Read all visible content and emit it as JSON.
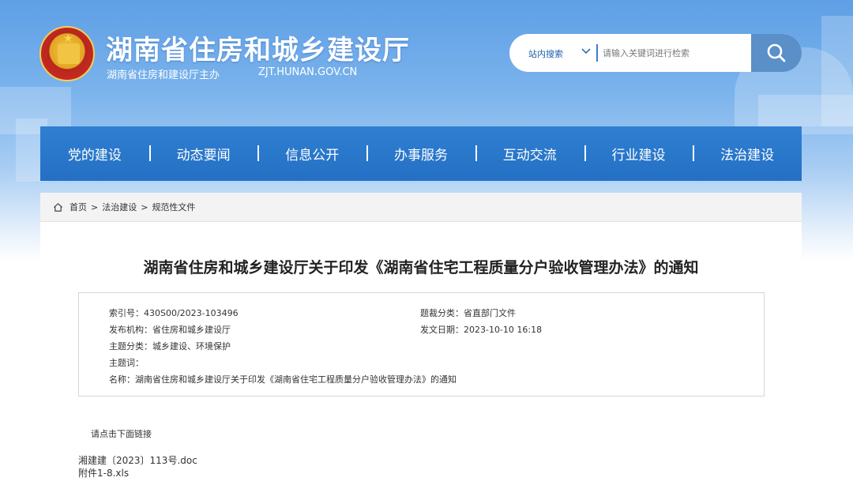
{
  "header": {
    "site_title": "湖南省住房和城乡建设厅",
    "site_sub": "湖南省住房和建设厅主办",
    "site_url": "ZJT.HUNAN.GOV.CN",
    "emblem_icon": "national-emblem"
  },
  "search": {
    "scope_label": "站内搜索",
    "placeholder": "请输入关键词进行检索",
    "button_icon": "search-icon"
  },
  "nav": {
    "items": [
      {
        "label": "党的建设"
      },
      {
        "label": "动态要闻"
      },
      {
        "label": "信息公开"
      },
      {
        "label": "办事服务"
      },
      {
        "label": "互动交流"
      },
      {
        "label": "行业建设"
      },
      {
        "label": "法治建设"
      }
    ]
  },
  "breadcrumb": {
    "items": [
      "首页",
      "法治建设",
      "规范性文件"
    ],
    "separator": ">"
  },
  "article": {
    "title": "湖南省住房和城乡建设厅关于印发《湖南省住宅工程质量分户验收管理办法》的通知",
    "meta": {
      "index_label": "索引号：",
      "index_value": "430S00/2023-103496",
      "category_label": "题裁分类：",
      "category_value": "省直部门文件",
      "issuer_label": "发布机构：",
      "issuer_value": "省住房和城乡建设厅",
      "date_label": "发文日期：",
      "date_value": "2023-10-10 16:18",
      "topic_label": "主题分类：",
      "topic_value": "城乡建设、环境保护",
      "keywords_label": "主题词：",
      "keywords_value": "",
      "name_label": "名称：",
      "name_value": "湖南省住房和城乡建设厅关于印发《湖南省住宅工程质量分户验收管理办法》的通知"
    },
    "links_hint": "请点击下面链接",
    "attachments": [
      "湘建建〔2023〕113号.doc",
      "附件1-8.xls"
    ]
  },
  "colors": {
    "nav_bg": "#2a76c9",
    "header_bg": "#6aa7e8",
    "search_button": "#5a8fc8"
  }
}
